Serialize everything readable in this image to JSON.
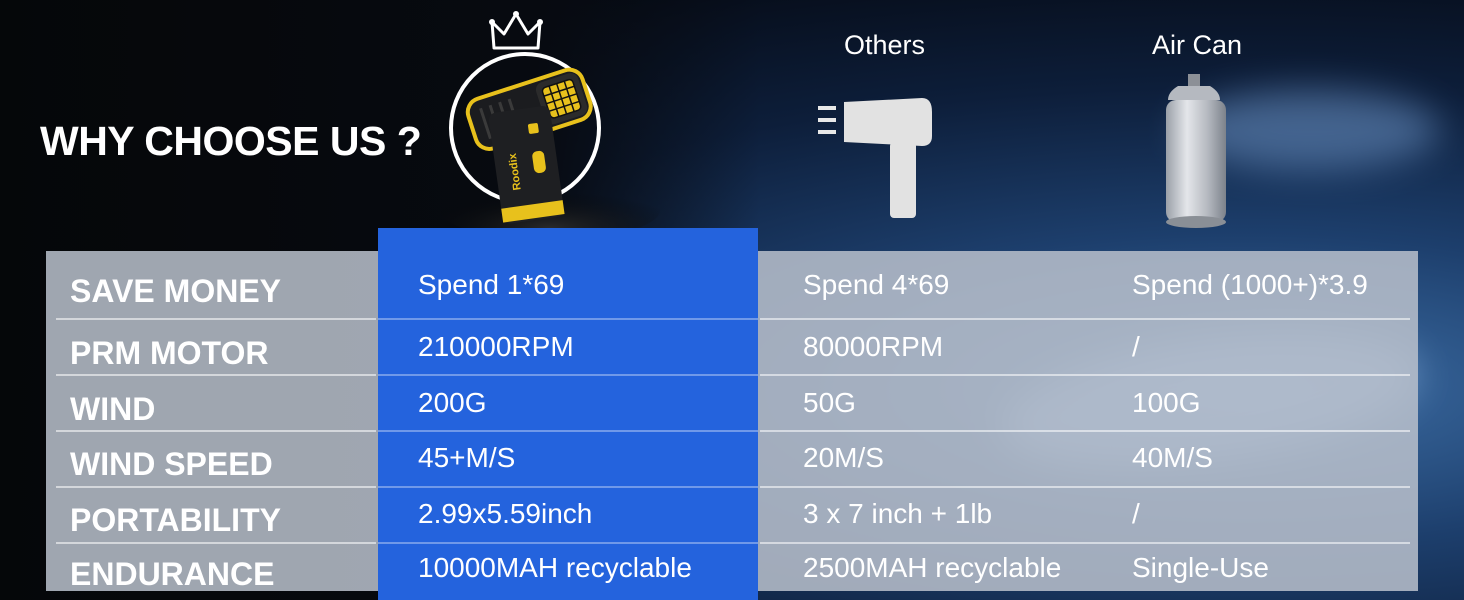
{
  "header": {
    "title": "WHY CHOOSE US ?",
    "columns": [
      "Others",
      "Air Can"
    ]
  },
  "product": {
    "brand_text": "Roodix"
  },
  "table": {
    "rows": [
      {
        "label": "SAVE MONEY",
        "ours": "Spend 1*69",
        "others": "Spend 4*69",
        "aircan": "Spend (1000+)*3.9"
      },
      {
        "label": "PRM MOTOR",
        "ours": "210000RPM",
        "others": "80000RPM",
        "aircan": "/"
      },
      {
        "label": "WIND",
        "ours": "200G",
        "others": "50G",
        "aircan": "100G"
      },
      {
        "label": "WIND SPEED",
        "ours": "45+M/S",
        "others": "20M/S",
        "aircan": "40M/S"
      },
      {
        "label": "PORTABILITY",
        "ours": "2.99x5.59inch",
        "others": "3 x 7 inch + 1lb",
        "aircan": "/"
      },
      {
        "label": "ENDURANCE",
        "ours": "10000MAH recyclable",
        "others": "2500MAH recyclable",
        "aircan": "Single-Use"
      }
    ]
  },
  "colors": {
    "highlight": "#2463dd",
    "table_bg": "#b9c0cc",
    "text": "#ffffff"
  },
  "icons": [
    "crown-icon",
    "blower-device-icon",
    "hair-dryer-icon",
    "air-can-icon"
  ]
}
